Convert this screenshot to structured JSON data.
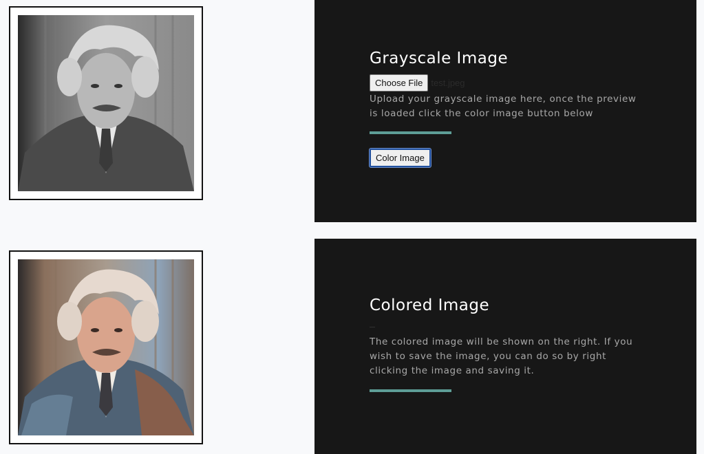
{
  "images": {
    "grayscale_alt": "Grayscale portrait preview",
    "colored_alt": "Colorized portrait result"
  },
  "upload_panel": {
    "title": "Grayscale Image",
    "choose_file_label": "Choose File",
    "file_name": "test.jpeg",
    "description": "Upload your grayscale image here, once the preview is loaded click the color image button below",
    "button_label": "Color Image",
    "accent_color": "#5e9e97"
  },
  "result_panel": {
    "title": "Colored Image",
    "description": "The colored image will be shown on the right. If you wish to save the image, you can do so by right clicking the image and saving it.",
    "accent_color": "#5e9e97"
  }
}
